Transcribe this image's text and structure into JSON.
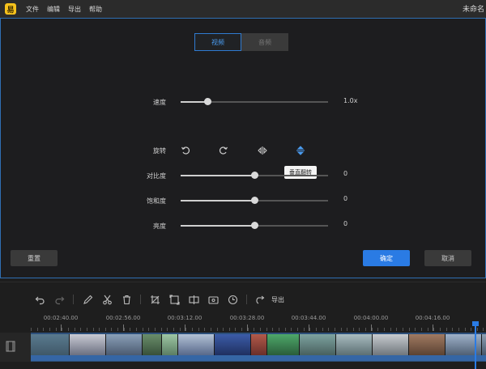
{
  "menubar": {
    "logo_glyph": "易",
    "items": [
      "文件",
      "编辑",
      "导出",
      "帮助"
    ],
    "window_title": "未命名"
  },
  "dialog": {
    "tabs": [
      {
        "label": "视频",
        "active": true
      },
      {
        "label": "音频",
        "active": false
      }
    ],
    "speed": {
      "label": "速度",
      "value": "1.0x",
      "level": 0.18
    },
    "rotate": {
      "label": "旋转",
      "buttons": [
        "rotate-left-icon",
        "rotate-right-icon",
        "flip-horizontal-icon",
        "flip-vertical-icon"
      ],
      "tooltip": "垂直翻转"
    },
    "contrast": {
      "label": "对比度",
      "value": "0",
      "level": 0.5
    },
    "saturation": {
      "label": "饱和度",
      "value": "0",
      "level": 0.5
    },
    "brightness": {
      "label": "亮度",
      "value": "0",
      "level": 0.5
    },
    "reset_label": "重置",
    "ok_label": "确定",
    "cancel_label": "取消"
  },
  "timeline": {
    "toolbar": {
      "icons": [
        "undo-icon",
        "redo-icon",
        "pen-icon",
        "scissors-icon",
        "trash-icon",
        "crop-icon",
        "resize-icon",
        "split-icon",
        "screen-icon",
        "clock-icon"
      ],
      "export_label": "导出"
    },
    "ruler_labels": [
      "00:02:40.00",
      "00:02:56.00",
      "00:03:12.00",
      "00:03:28.00",
      "00:03:44.00",
      "00:04:00.00",
      "00:04:16.00"
    ],
    "colors": {
      "accent": "#2a7be4",
      "track": "#2c4f7a"
    }
  }
}
